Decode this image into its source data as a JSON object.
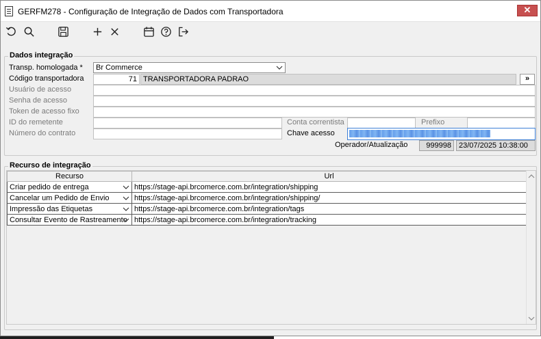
{
  "window": {
    "title": "GERFM278 - Configuração de Integração de Dados com Transportadora",
    "close_label": "✕"
  },
  "toolbar": {
    "icons": [
      "undo-icon",
      "search-icon",
      "save-icon",
      "add-icon",
      "delete-icon",
      "calendar-icon",
      "help-icon",
      "exit-icon"
    ]
  },
  "dados": {
    "title": "Dados integração",
    "transp_label": "Transp. homologada *",
    "transp_value": "Br Commerce",
    "codigo_label": "Código transportadora",
    "codigo_value": "71",
    "codigo_name": "TRANSPORTADORA PADRAO",
    "more_label": "»",
    "usuario_label": "Usuário de acesso",
    "usuario_value": "",
    "senha_label": "Senha de acesso",
    "senha_value": "",
    "token_label": "Token de acesso fixo",
    "token_value": "",
    "id_label": "ID do remetente",
    "id_value": "",
    "numero_label": "Número do contrato",
    "numero_value": "",
    "conta_label": "Conta correntista",
    "conta_value": "",
    "prefixo_label": "Prefixo",
    "prefixo_value": "",
    "chave_label": "Chave acesso",
    "operador_label": "Operador/Atualização",
    "operador_value": "999998",
    "atualizacao_value": "23/07/2025 10:38:00"
  },
  "recurso": {
    "title": "Recurso de integração",
    "columns": [
      "Recurso",
      "Url"
    ],
    "rows": [
      {
        "recurso": "Criar pedido de entrega",
        "url": "https://stage-api.brcomerce.com.br/integration/shipping"
      },
      {
        "recurso": "Cancelar um Pedido de Envio",
        "url": "https://stage-api.brcomerce.com.br/integration/shipping/"
      },
      {
        "recurso": "Impressão das Etiquetas",
        "url": "https://stage-api.brcomerce.com.br/integration/tags"
      },
      {
        "recurso": "Consultar Evento de Rastreamento",
        "url": "https://stage-api.brcomerce.com.br/integration/tracking"
      }
    ]
  },
  "colors": {
    "disabled_text": "#7a7a7a",
    "close_button": "#c75050",
    "focus_border": "#3c7fd6"
  }
}
